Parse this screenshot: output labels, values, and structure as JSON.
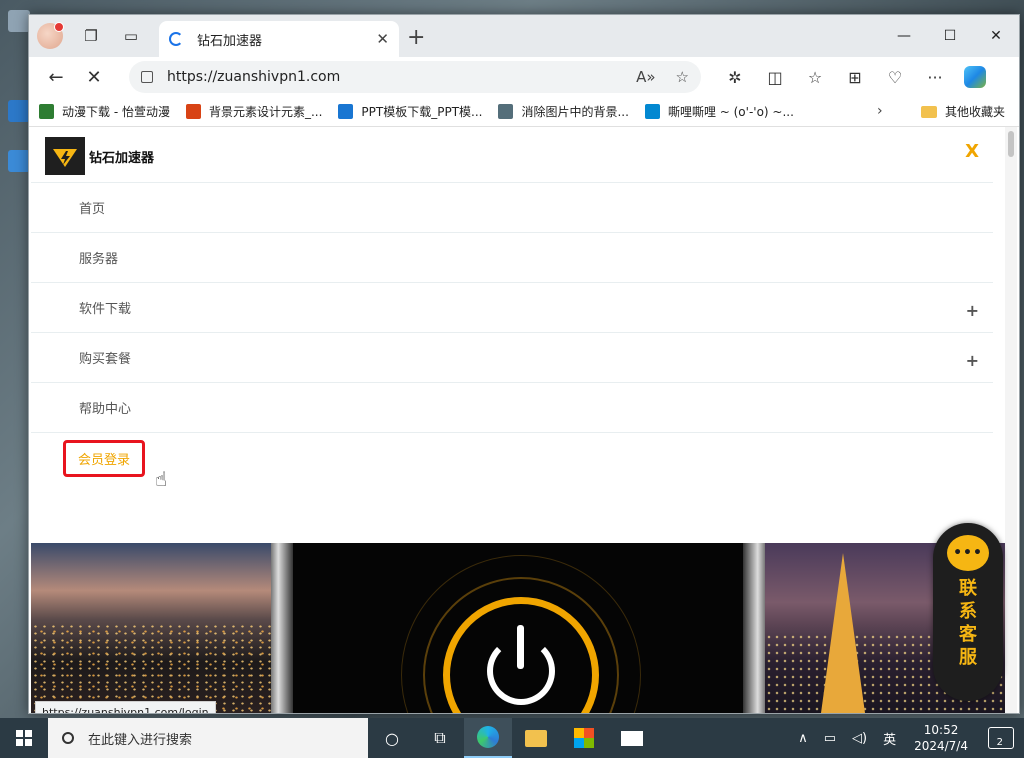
{
  "browser": {
    "tab_title": "钻石加速器",
    "url": "https://zuanshivpn1.com",
    "favorites": [
      {
        "label": "动漫下载 - 怡萱动漫",
        "color": "#2e7d32"
      },
      {
        "label": "背景元素设计元素_...",
        "color": "#d84315"
      },
      {
        "label": "PPT模板下载_PPT模...",
        "color": "#1976d2"
      },
      {
        "label": "消除图片中的背景...",
        "color": "#546e7a"
      },
      {
        "label": "嘶哩嘶哩 ~ (o'-'o) ~...",
        "color": "#0288d1"
      }
    ],
    "favorites_folder": "其他收藏夹",
    "status_url": "https://zuanshivpn1.com/login"
  },
  "site": {
    "name": "钻石加速器",
    "close_label": "X",
    "menu": [
      {
        "label": "首页",
        "expandable": false
      },
      {
        "label": "服务器",
        "expandable": false
      },
      {
        "label": "软件下载",
        "expandable": true
      },
      {
        "label": "购买套餐",
        "expandable": true
      },
      {
        "label": "帮助中心",
        "expandable": false
      }
    ],
    "login_label": "会员登录",
    "customer_service": {
      "bubble": "•••",
      "label": "联系客服"
    },
    "accent_color": "#f0a500"
  },
  "taskbar": {
    "search_placeholder": "在此键入进行搜索",
    "ime": "英",
    "time": "10:52",
    "date": "2024/7/4",
    "notifications": "2"
  }
}
